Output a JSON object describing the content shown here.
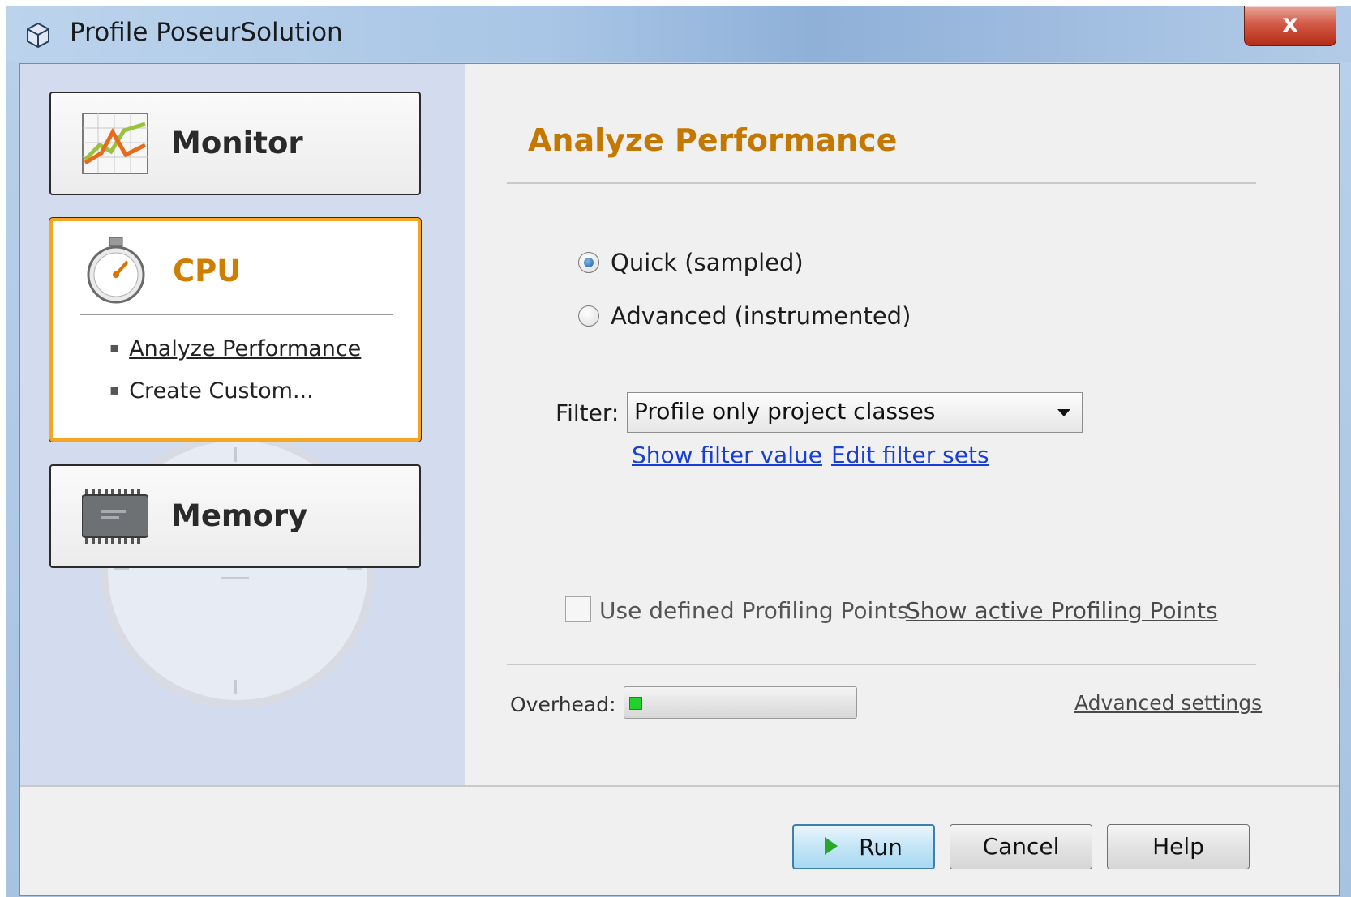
{
  "window": {
    "title": "Profile PoseurSolution",
    "close_label": "x"
  },
  "sidebar": {
    "categories": [
      {
        "label": "Monitor"
      },
      {
        "label": "CPU",
        "items": [
          {
            "label": "Analyze Performance"
          },
          {
            "label": "Create Custom..."
          }
        ]
      },
      {
        "label": "Memory"
      }
    ]
  },
  "panel": {
    "title": "Analyze Performance",
    "options": [
      {
        "label": "Quick (sampled)",
        "checked": true
      },
      {
        "label": "Advanced (instrumented)",
        "checked": false
      }
    ],
    "filter": {
      "label": "Filter:",
      "value": "Profile only project classes",
      "show_link": "Show filter value",
      "edit_link": "Edit filter sets"
    },
    "profiling_points": {
      "checkbox_label": "Use defined Profiling Points",
      "checked": false,
      "link": "Show active Profiling Points"
    },
    "overhead": {
      "label": "Overhead:",
      "level_fraction": 0.05
    },
    "advanced_link": "Advanced settings"
  },
  "buttons": {
    "run": "Run",
    "cancel": "Cancel",
    "help": "Help"
  },
  "colors": {
    "accent": "#cf7e00",
    "link": "#1a3fd6",
    "selection_border": "#f5a623",
    "overhead_fill": "#22d22a"
  }
}
